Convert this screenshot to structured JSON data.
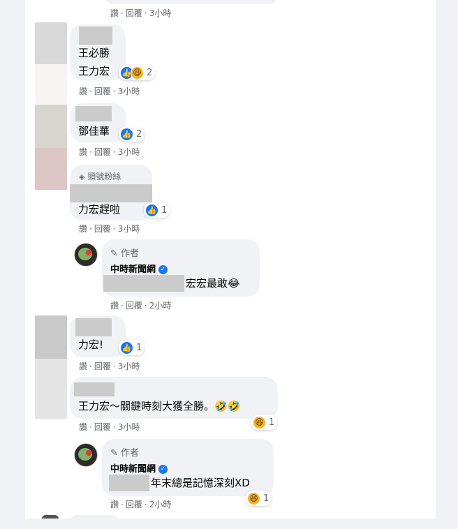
{
  "actions": {
    "like": "讚",
    "reply": "回覆",
    "sep": "·"
  },
  "icons": {
    "like": "like-icon",
    "haha": "haha-icon",
    "pencil": "pencil-icon",
    "verified": "verified-badge-icon",
    "diamond": "diamond-icon"
  },
  "colors": {
    "bubble": "#f0f2f5",
    "like_blue": "#1877f2",
    "haha_yellow": "#f7b125",
    "meta_gray": "#65676b"
  },
  "comments": [
    {
      "text": null,
      "time": "3小時"
    },
    {
      "text_line1": "王必勝",
      "text_line2": "王力宏",
      "reaction_count": "2",
      "time": "3小時"
    },
    {
      "text": "鄧佳華",
      "reaction_count": "2",
      "time": "3小時"
    },
    {
      "badge": "頭號粉絲",
      "text": "力宏趕啦",
      "reaction_count": "1",
      "time": "3小時"
    },
    {
      "author_label": "作者",
      "author": "中時新聞網",
      "text": "宏宏最敢😂",
      "time": "2小時"
    },
    {
      "text": "力宏!",
      "reaction_count": "1",
      "time": "3小時"
    },
    {
      "text": "王力宏～關鍵時刻大獲全勝。🤣🤣",
      "reaction_count": "1",
      "time": "3小時"
    },
    {
      "author_label": "作者",
      "author": "中時新聞網",
      "text": "年末總是記憶深刻XD",
      "reaction_count": "1",
      "time": "2小時"
    }
  ]
}
